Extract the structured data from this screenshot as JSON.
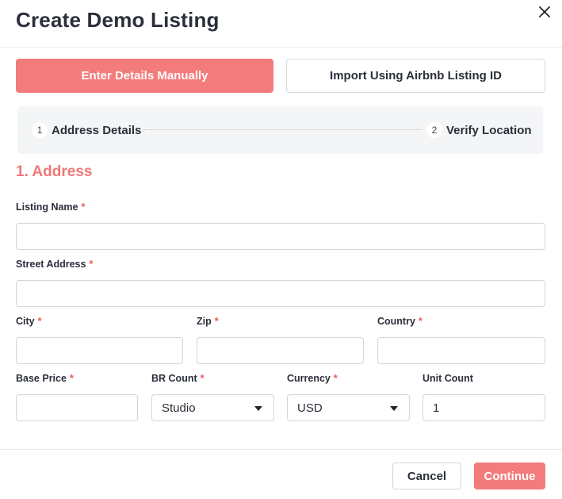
{
  "dialog": {
    "title": "Create Demo Listing"
  },
  "tabs": {
    "manual": "Enter Details Manually",
    "import": "Import Using Airbnb Listing ID"
  },
  "stepper": {
    "steps": [
      {
        "num": "1",
        "label": "Address Details"
      },
      {
        "num": "2",
        "label": "Verify Location"
      }
    ]
  },
  "section": {
    "title": "1. Address"
  },
  "required_mark": "*",
  "fields": {
    "listing_name": {
      "label": "Listing Name",
      "value": ""
    },
    "street_address": {
      "label": "Street Address",
      "value": ""
    },
    "city": {
      "label": "City",
      "value": ""
    },
    "zip": {
      "label": "Zip",
      "value": ""
    },
    "country": {
      "label": "Country",
      "value": ""
    },
    "base_price": {
      "label": "Base Price",
      "value": ""
    },
    "br_count": {
      "label": "BR Count",
      "value": "Studio"
    },
    "currency": {
      "label": "Currency",
      "value": "USD"
    },
    "unit_count": {
      "label": "Unit Count",
      "value": "1"
    }
  },
  "buttons": {
    "cancel": "Cancel",
    "continue": "Continue"
  },
  "colors": {
    "accent": "#f47b7b",
    "required": "#e85a5a",
    "section_title": "#f07878",
    "stepper_bg": "#f4f5f7"
  }
}
